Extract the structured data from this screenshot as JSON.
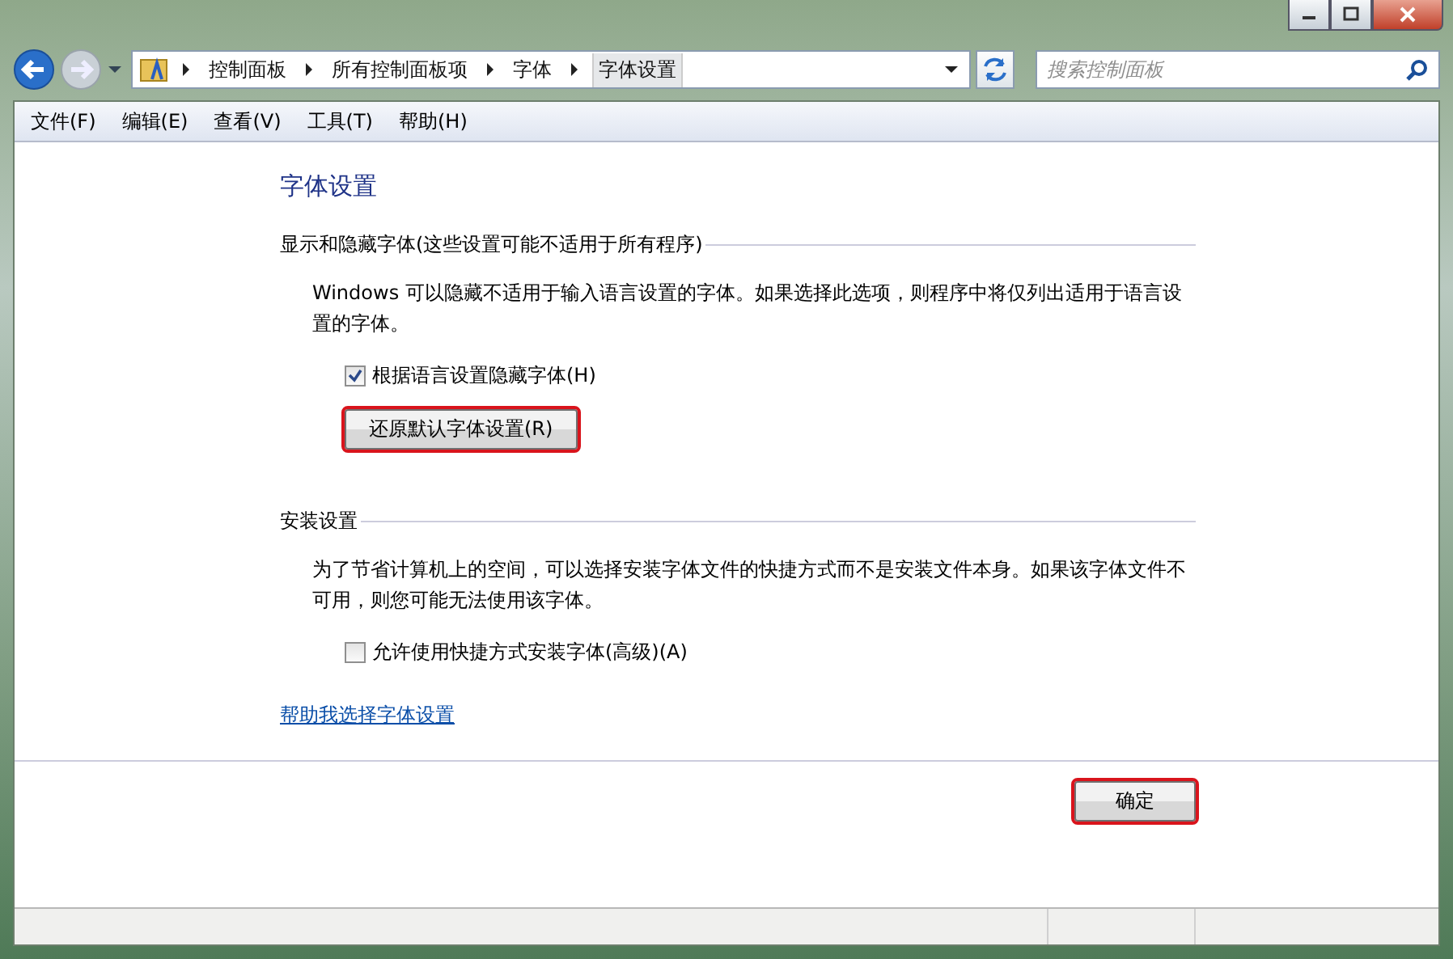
{
  "address_bar": {
    "breadcrumbs": [
      {
        "label": "控制面板",
        "selected": false
      },
      {
        "label": "所有控制面板项",
        "selected": false
      },
      {
        "label": "字体",
        "selected": false
      },
      {
        "label": "字体设置",
        "selected": true
      }
    ]
  },
  "search": {
    "placeholder": "搜索控制面板"
  },
  "menu": [
    "文件(F)",
    "编辑(E)",
    "查看(V)",
    "工具(T)",
    "帮助(H)"
  ],
  "title": "字体设置",
  "sections": [
    {
      "heading": "显示和隐藏字体(这些设置可能不适用于所有程序)",
      "description": "Windows 可以隐藏不适用于输入语言设置的字体。如果选择此选项，则程序中将仅列出适用于语言设置的字体。",
      "options": [
        {
          "kind": "checkbox",
          "label": "根据语言设置隐藏字体(H)",
          "checked": true
        },
        {
          "kind": "button",
          "label": "还原默认字体设置(R)",
          "highlighted": true
        }
      ]
    },
    {
      "heading": "安装设置",
      "description": "为了节省计算机上的空间，可以选择安装字体文件的快捷方式而不是安装文件本身。如果该字体文件不可用，则您可能无法使用该字体。",
      "options": [
        {
          "kind": "checkbox",
          "label": "允许使用快捷方式安装字体(高级)(A)",
          "checked": false
        }
      ]
    }
  ],
  "help_link": "帮助我选择字体设置",
  "footer_buttons": [
    {
      "label": "确定",
      "highlighted": true
    }
  ]
}
